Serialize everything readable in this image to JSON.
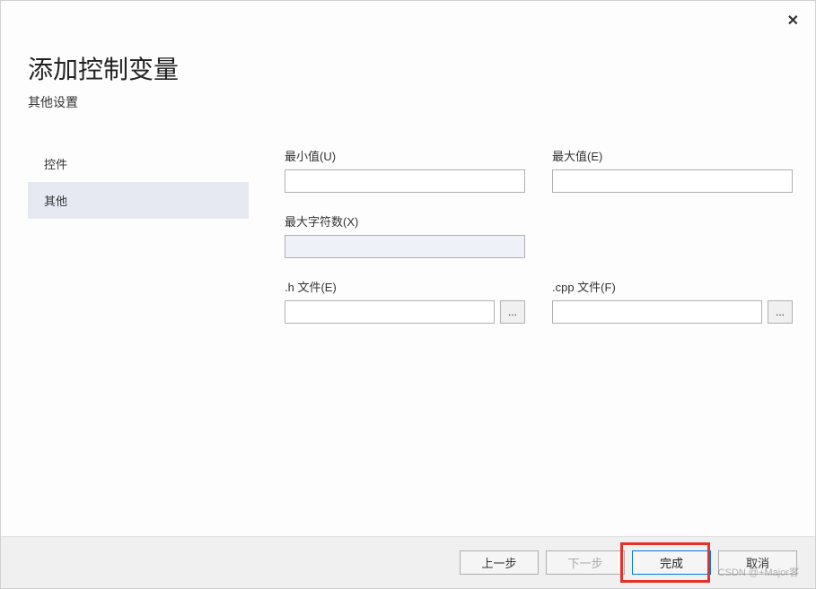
{
  "header": {
    "title": "添加控制变量",
    "subtitle": "其他设置"
  },
  "close_label": "✕",
  "sidebar": {
    "items": [
      {
        "label": "控件",
        "selected": false
      },
      {
        "label": "其他",
        "selected": true
      }
    ]
  },
  "form": {
    "min_value": {
      "label": "最小值(U)",
      "value": ""
    },
    "max_value": {
      "label": "最大值(E)",
      "value": ""
    },
    "max_chars": {
      "label": "最大字符数(X)",
      "value": ""
    },
    "h_file": {
      "label": ".h 文件(E)",
      "value": "",
      "browse": "..."
    },
    "cpp_file": {
      "label": ".cpp 文件(F)",
      "value": "",
      "browse": "..."
    }
  },
  "footer": {
    "prev": "上一步",
    "next": "下一步",
    "finish": "完成",
    "cancel": "取消"
  },
  "watermark": "CSDN @+Major客"
}
